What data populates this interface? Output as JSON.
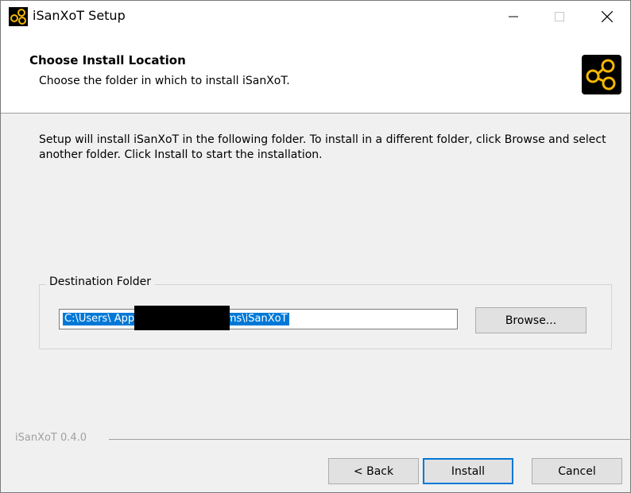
{
  "window": {
    "title": "iSanXoT Setup"
  },
  "header": {
    "title": "Choose Install Location",
    "subtitle": "Choose the folder in which to install iSanXoT."
  },
  "content": {
    "description": "Setup will install iSanXoT in the following folder. To install in a different folder, click Browse and select another folder. Click Install to start the installation."
  },
  "destination": {
    "label": "Destination Folder",
    "path_value": "C:\\Users\\                AppData\\Local\\Programs\\iSanXoT",
    "browse_label": "Browse..."
  },
  "footer": {
    "version": "iSanXoT 0.4.0",
    "back_label": "< Back",
    "install_label": "Install",
    "cancel_label": "Cancel"
  },
  "icons": {
    "app": "isanxot-logo-icon",
    "header": "isanxot-logo-icon"
  },
  "colors": {
    "selection": "#0078d7",
    "logo_bg": "#000000",
    "logo_fg": "#f5b800"
  }
}
